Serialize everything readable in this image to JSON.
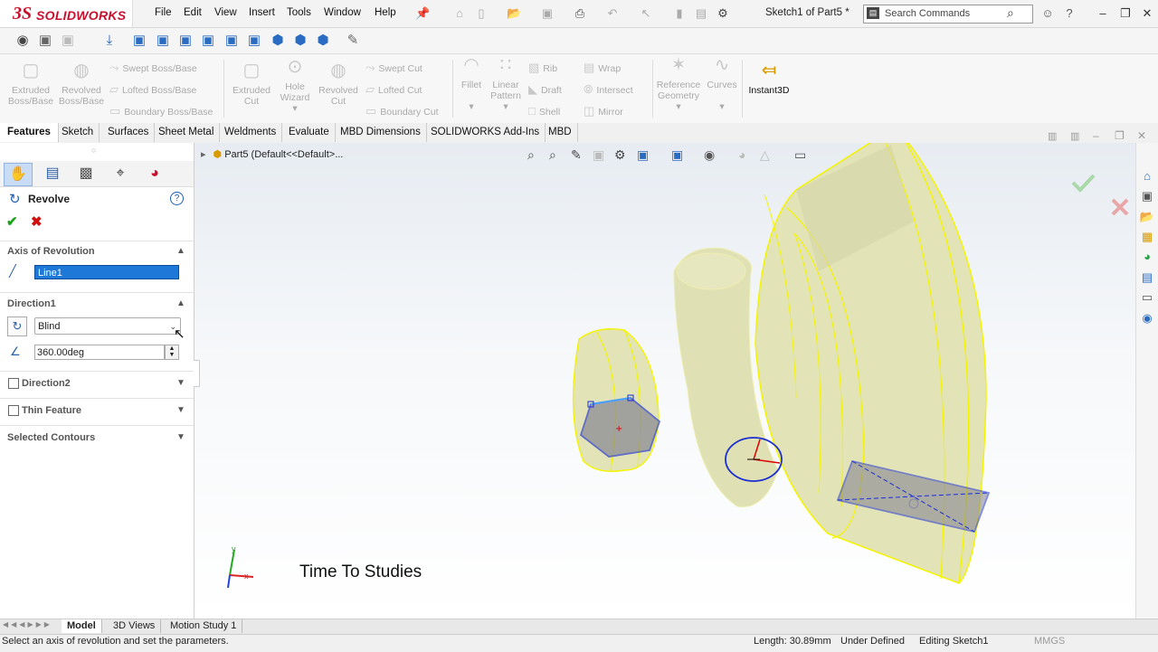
{
  "app": {
    "brand_prefix": "3S",
    "brand": "SOLIDWORKS",
    "document_title": "Sketch1 of Part5 *"
  },
  "menu": [
    "File",
    "Edit",
    "View",
    "Insert",
    "Tools",
    "Window",
    "Help"
  ],
  "search": {
    "placeholder": "Search Commands"
  },
  "command_manager": {
    "big": [
      {
        "label1": "Extruded",
        "label2": "Boss/Base"
      },
      {
        "label1": "Revolved",
        "label2": "Boss/Base"
      },
      {
        "label1": "Extruded",
        "label2": "Cut"
      },
      {
        "label1": "Hole",
        "label2": "Wizard"
      },
      {
        "label1": "Revolved",
        "label2": "Cut"
      },
      {
        "label1": "Fillet",
        "label2": ""
      },
      {
        "label1": "Linear",
        "label2": "Pattern"
      },
      {
        "label1": "Reference",
        "label2": "Geometry"
      },
      {
        "label1": "Curves",
        "label2": ""
      },
      {
        "label1": "Instant3D",
        "label2": ""
      }
    ],
    "small": [
      "Swept Boss/Base",
      "Lofted Boss/Base",
      "Boundary Boss/Base",
      "Swept Cut",
      "Lofted Cut",
      "Boundary Cut",
      "Rib",
      "Draft",
      "Shell",
      "Wrap",
      "Intersect",
      "Mirror"
    ]
  },
  "tabs": [
    "Features",
    "Sketch",
    "Surfaces",
    "Sheet Metal",
    "Weldments",
    "Evaluate",
    "MBD Dimensions",
    "SOLIDWORKS Add-Ins",
    "MBD"
  ],
  "property_manager": {
    "title": "Revolve",
    "axis_section": "Axis of Revolution",
    "axis_value": "Line1",
    "direction1_section": "Direction1",
    "direction1_type": "Blind",
    "angle": "360.00deg",
    "direction2": "Direction2",
    "thin_feature": "Thin Feature",
    "selected_contours": "Selected Contours"
  },
  "tree": {
    "part": "Part5  (Default<<Default>..."
  },
  "watermark": "Time To Studies",
  "bottom_tabs": [
    "Model",
    "3D Views",
    "Motion Study 1"
  ],
  "status": {
    "hint": "Select an axis of revolution and set the parameters.",
    "length": "Length: 30.89mm",
    "state": "Under Defined",
    "editing": "Editing Sketch1",
    "units": "MMGS"
  },
  "triad": {
    "x": "x",
    "y": "y"
  },
  "colors": {
    "accent": "#1e78d7",
    "brand": "#c8102e",
    "part_fill": "#e3e3b8",
    "sketch": "#1a2fd0",
    "edge": "#ffff33"
  }
}
